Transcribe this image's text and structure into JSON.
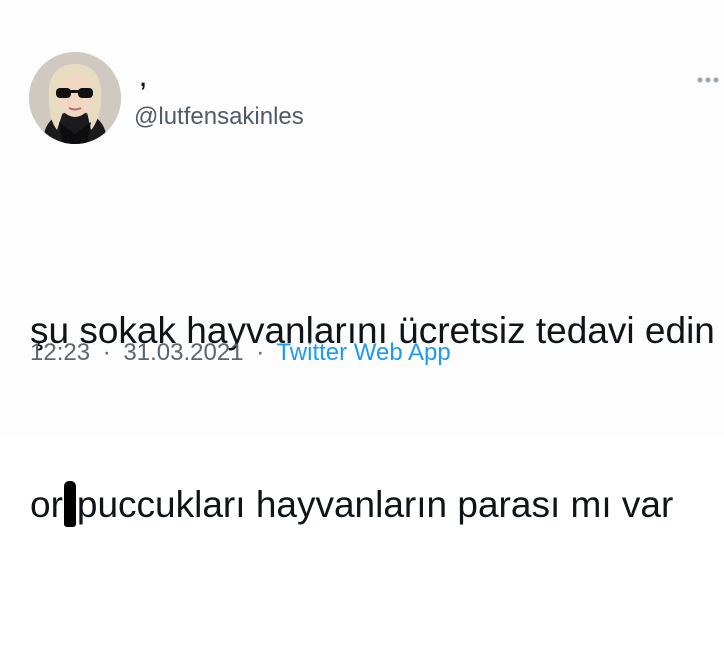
{
  "tweet": {
    "author": {
      "display_name": ",",
      "handle": "@lutfensakinles",
      "avatar": "profile-photo"
    },
    "text_line1": "şu sokak hayvanlarını ücretsiz tedavi edin",
    "text_line2_start": "or",
    "text_line2_end": "puccukları hayvanların parası mı var",
    "time": "12:23",
    "separator": "·",
    "date": "31.03.2021",
    "source": "Twitter Web App"
  },
  "icons": {
    "more": "more-options-icon",
    "censor": "censor-mark"
  },
  "colors": {
    "text": "#0f1419",
    "secondary": "#5b6670",
    "link": "#1d9bf0"
  }
}
